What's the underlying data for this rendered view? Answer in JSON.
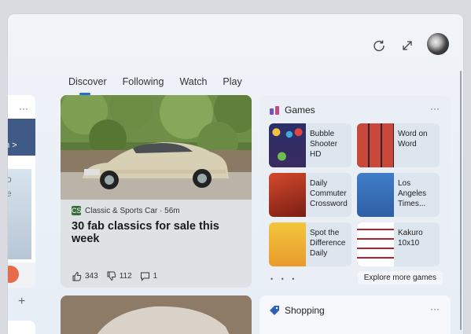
{
  "tabs": [
    "Discover",
    "Following",
    "Watch",
    "Play"
  ],
  "active_tab": "Discover",
  "left_card": {
    "label": "on >",
    "thumb_text": [
      "So",
      "Be"
    ],
    "more": "···"
  },
  "plus": "+",
  "news": {
    "source": "Classic & Sports Car · 56m",
    "source_icon": "CS",
    "headline": "30 fab classics for sale this week",
    "likes": "343",
    "dislikes": "112",
    "comments": "1"
  },
  "games": {
    "title": "Games",
    "more": "···",
    "items": [
      {
        "name": "Bubble Shooter HD"
      },
      {
        "name": "Word on Word"
      },
      {
        "name": "Daily Commuter Crossword"
      },
      {
        "name": "Los Angeles Times..."
      },
      {
        "name": "Spot the Difference Daily"
      },
      {
        "name": "Kakuro 10x10"
      }
    ],
    "dots": "• • •",
    "explore": "Explore more games"
  },
  "shopping": {
    "title": "Shopping",
    "more": "···"
  },
  "colors": {
    "accent": "#2a6ad3",
    "shopping_icon": "#2f5fb8",
    "games_icon": "#6b56c8"
  }
}
